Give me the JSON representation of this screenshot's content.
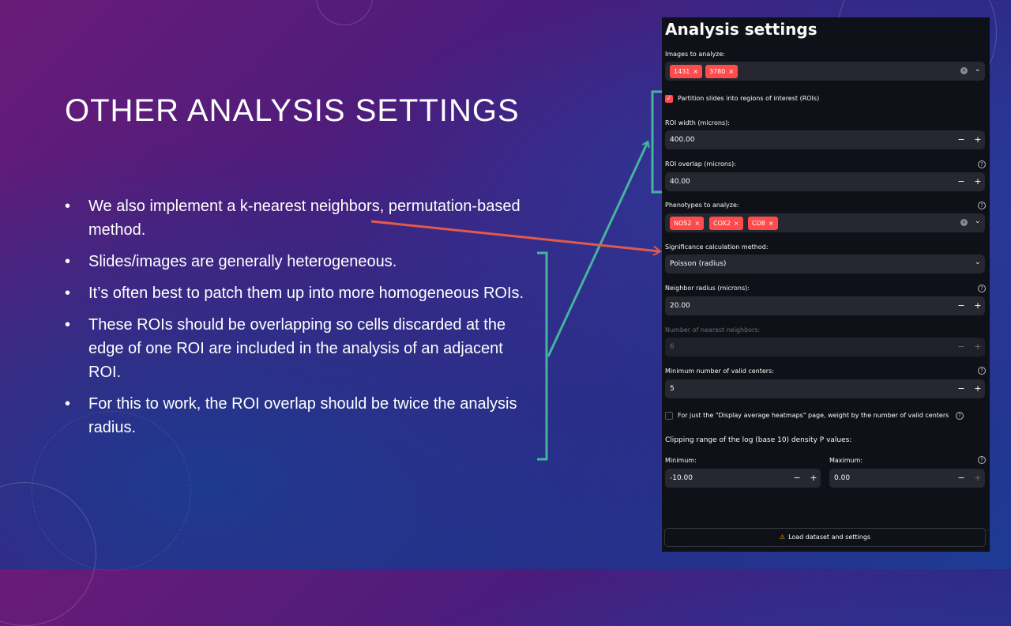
{
  "slide": {
    "title": "OTHER ANALYSIS SETTINGS",
    "bullets": [
      "We also implement a k-nearest neighbors, permutation-based method.",
      "Slides/images are generally heterogeneous.",
      "It’s often best to patch them up into more homogeneous ROIs.",
      "These ROIs should be overlapping so cells discarded at the edge of one ROI are included in the analysis of an adjacent ROI.",
      "For this to work, the ROI overlap should be twice the analysis radius."
    ],
    "bullet_symbol": "•"
  },
  "panel": {
    "title": "Analysis settings",
    "images_label": "Images to analyze:",
    "images": [
      "1431",
      "3780"
    ],
    "partition_label": "Partition slides into regions of interest (ROIs)",
    "partition_checked": true,
    "roi_width_label": "ROI width (microns):",
    "roi_width": "400.00",
    "roi_overlap_label": "ROI overlap (microns):",
    "roi_overlap": "40.00",
    "phenotypes_label": "Phenotypes to analyze:",
    "phenotypes": [
      "NOS2",
      "COX2",
      "CD8"
    ],
    "significance_label": "Significance calculation method:",
    "significance": "Poisson (radius)",
    "neighbor_radius_label": "Neighbor radius (microns):",
    "neighbor_radius": "20.00",
    "nearest_label": "Number of nearest neighbors:",
    "nearest": "6",
    "min_centers_label": "Minimum number of valid centers:",
    "min_centers": "5",
    "heatmap_weight_label": "For just the \"Display average heatmaps\" page, weight by the number of valid centers",
    "heatmap_weight_checked": false,
    "clipping_label": "Clipping range of the log (base 10) density P values:",
    "min_label": "Minimum:",
    "min_value": "-10.00",
    "max_label": "Maximum:",
    "max_value": "0.00",
    "load_button": "Load dataset and settings",
    "minus": "−",
    "plus": "+",
    "tag_x": "×",
    "clear_x": "×",
    "chevron": "⌄",
    "help": "?",
    "check": "✓",
    "warn_icon": "⚠"
  },
  "colors": {
    "accent": "#ff4b4b",
    "panel_bg": "#0e1117",
    "input_bg": "#262730",
    "bracket_teal": "#45b39d",
    "arrow_red": "#e05a4e"
  }
}
